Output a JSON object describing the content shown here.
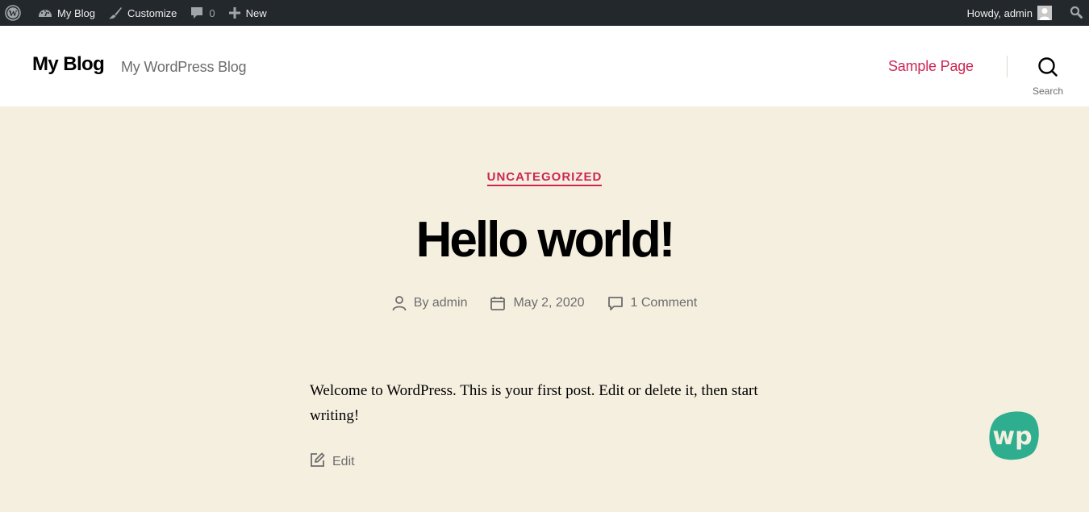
{
  "admin_bar": {
    "wp_logo_icon": "wordpress-logo-icon",
    "site_name": "My Blog",
    "site_icon": "dashboard-gauge-icon",
    "customize_label": "Customize",
    "customize_icon": "paintbrush-icon",
    "comments_count": "0",
    "comments_icon": "comment-bubble-icon",
    "new_label": "New",
    "new_icon": "plus-icon",
    "greeting": "Howdy, admin",
    "avatar_icon": "user-avatar-icon",
    "search_icon": "search-icon"
  },
  "header": {
    "site_title": "My Blog",
    "site_description": "My WordPress Blog",
    "nav": [
      {
        "label": "Sample Page"
      }
    ],
    "search_label": "Search"
  },
  "post": {
    "category": "UNCATEGORIZED",
    "title": "Hello world!",
    "meta": {
      "author": "By admin",
      "date": "May 2, 2020",
      "comments": "1 Comment"
    },
    "content": "Welcome to WordPress. This is your first post. Edit or delete it, then start writing!",
    "edit_label": "Edit"
  },
  "badge": {
    "text": "wp",
    "color": "#2eae8f"
  },
  "colors": {
    "accent": "#cd2653",
    "admin_bar_bg": "#23282d",
    "page_bg": "#f5efe0",
    "header_bg": "#ffffff",
    "meta_text": "#6d6d6d"
  }
}
